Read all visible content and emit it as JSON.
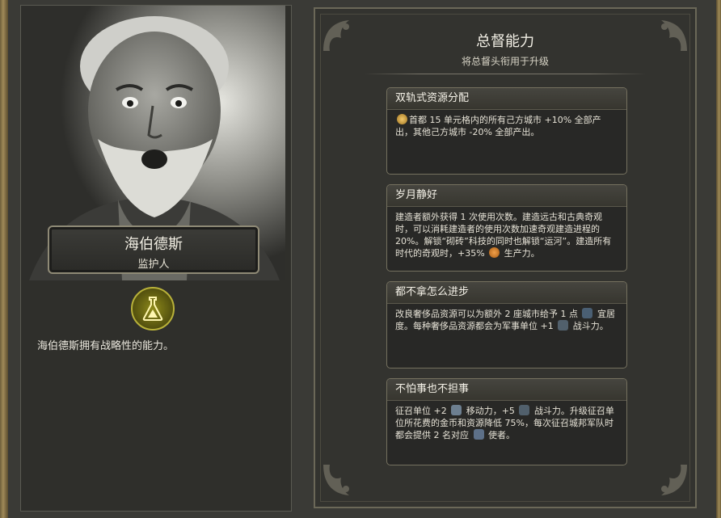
{
  "governor": {
    "name": "海伯德斯",
    "title": "监护人",
    "description": "海伯德斯拥有战略性的能力。",
    "icon": "flask-icon"
  },
  "panel": {
    "title": "总督能力",
    "subtitle": "将总督头衔用于升级"
  },
  "promotions": [
    {
      "name": "双轨式资源分配",
      "icon": "star-icon",
      "text": "首都 15 单元格内的所有己方城市 +10% 全部产出，其他己方城市 -20% 全部产出。"
    },
    {
      "name": "岁月静好",
      "text_before": "建造者额外获得 1 次使用次数。建造远古和古典奇观时，可以消耗建造者的使用次数加速奇观建造进程的 20%。解锁“砌砖”科技的同时也解锁“运河”。建造所有时代的奇观时，+35%",
      "icon": "production-icon",
      "text_after": "生产力。"
    },
    {
      "name": "都不拿怎么进步",
      "text_before": "改良奢侈品资源可以为额外 2 座城市给予 1 点",
      "icon_1": "amenity-icon",
      "text_mid": "宜居度。每种奢侈品资源都会为军事单位 +1",
      "icon_2": "strength-icon",
      "text_after": "战斗力。"
    },
    {
      "name": "不怕事也不担事",
      "text_1": "征召单位 +2",
      "icon_1": "movement-icon",
      "text_2": "移动力，+5",
      "icon_2": "strength-icon",
      "text_3": "战斗力。升级征召单位所花费的金币和资源降低 75%，每次征召城邦军队时都会提供 2 名对应",
      "icon_3": "envoy-icon",
      "text_4": "使者。"
    }
  ]
}
